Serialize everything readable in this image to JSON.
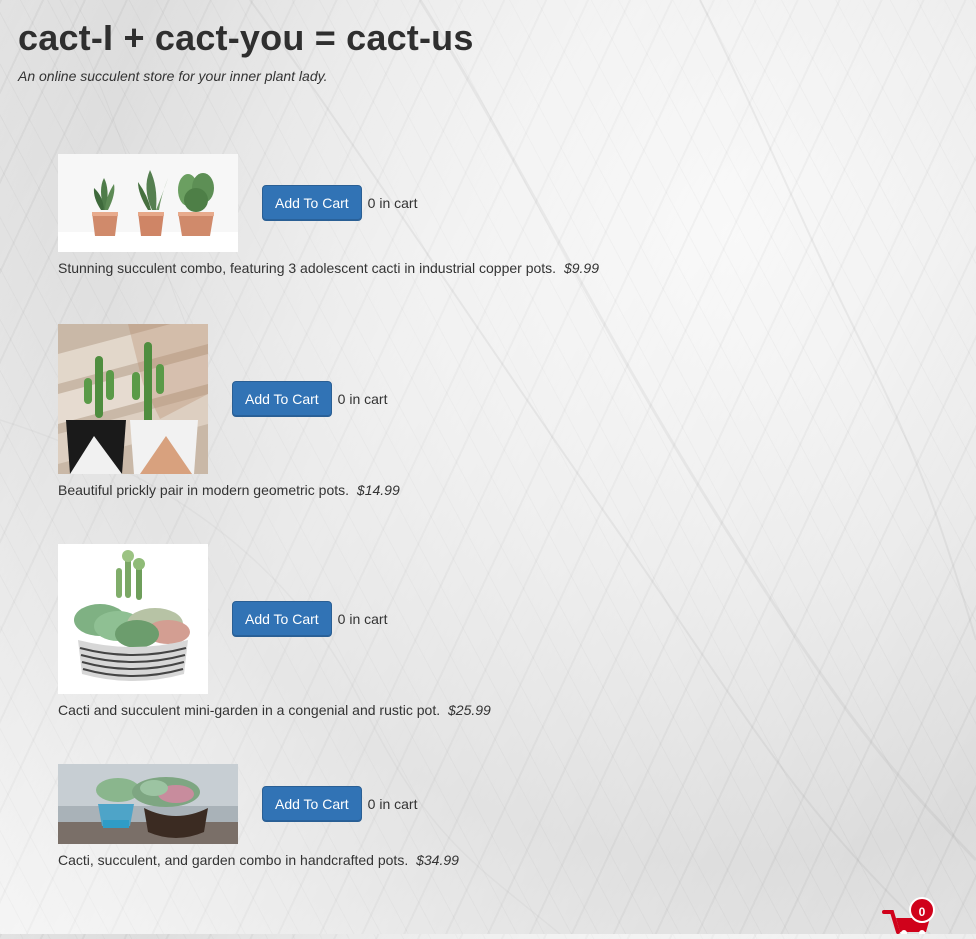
{
  "header": {
    "title": "cact-I + cact-you = cact-us",
    "subtitle": "An online succulent store for your inner plant lady."
  },
  "products": [
    {
      "image_icon": "copper-pot-cacti-image",
      "button_label": "Add To Cart",
      "cart_count_text": "0 in cart",
      "description": "Stunning succulent combo, featuring 3 adolescent cacti in industrial copper pots.",
      "price": "$9.99"
    },
    {
      "image_icon": "geometric-pot-cacti-image",
      "button_label": "Add To Cart",
      "cart_count_text": "0 in cart",
      "description": "Beautiful prickly pair in modern geometric pots.",
      "price": "$14.99"
    },
    {
      "image_icon": "mini-garden-image",
      "button_label": "Add To Cart",
      "cart_count_text": "0 in cart",
      "description": "Cacti and succulent mini-garden in a congenial and rustic pot.",
      "price": "$25.99"
    },
    {
      "image_icon": "handcrafted-pots-image",
      "button_label": "Add To Cart",
      "cart_count_text": "0 in cart",
      "description": "Cacti, succulent, and garden combo in handcrafted pots.",
      "price": "$34.99"
    }
  ],
  "cart": {
    "count": "0",
    "icon": "shopping-cart-icon",
    "color": "#d0021b"
  },
  "colors": {
    "button": "#3173b5",
    "badge": "#d0021b"
  }
}
